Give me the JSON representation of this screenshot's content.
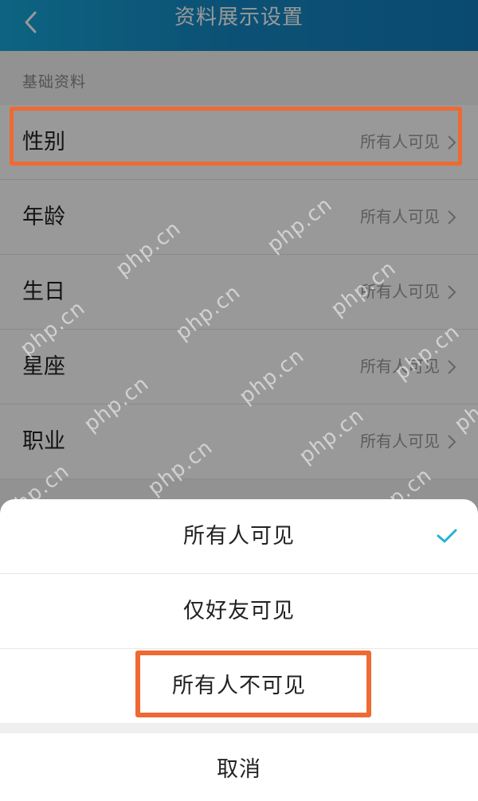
{
  "header": {
    "title": "资料展示设置",
    "back_icon": "chevron-left-icon"
  },
  "section": {
    "label": "基础资料"
  },
  "rows": [
    {
      "label": "性别",
      "value": "所有人可见"
    },
    {
      "label": "年龄",
      "value": "所有人可见"
    },
    {
      "label": "生日",
      "value": "所有人可见"
    },
    {
      "label": "星座",
      "value": "所有人可见"
    },
    {
      "label": "职业",
      "value": "所有人可见"
    }
  ],
  "sheet": {
    "options": [
      {
        "label": "所有人可见",
        "selected": true
      },
      {
        "label": "仅好友可见",
        "selected": false
      },
      {
        "label": "所有人不可见",
        "selected": false
      }
    ],
    "cancel": "取消"
  },
  "watermark": "php.cn",
  "colors": {
    "header_start": "#17a6d8",
    "header_end": "#127cbd",
    "highlight": "#ee6a33",
    "check": "#23b2d6"
  }
}
